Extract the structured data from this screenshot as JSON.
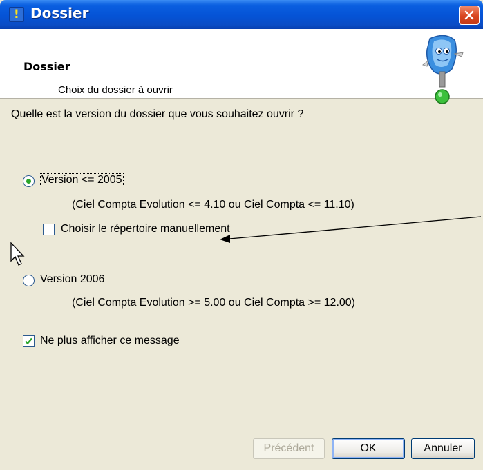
{
  "window": {
    "title": "Dossier",
    "icon": "help-doc-icon",
    "close_icon": "close-icon"
  },
  "header": {
    "title": "Dossier",
    "subtitle": "Choix du dossier à ouvrir",
    "mascot_icon": "ciel-mascot-icon"
  },
  "body": {
    "question": "Quelle est la version du dossier que vous souhaitez ouvrir ?",
    "option_2005": {
      "label": "Version <= 2005",
      "hint": "(Ciel Compta Evolution <= 4.10 ou Ciel Compta <= 11.10)",
      "selected": true
    },
    "manual_dir": {
      "label": "Choisir le répertoire manuellement",
      "checked": false
    },
    "option_2006": {
      "label": "Version 2006",
      "hint": "(Ciel Compta Evolution >= 5.00 ou Ciel Compta >= 12.00)",
      "selected": false
    },
    "no_show": {
      "label": "Ne plus afficher ce message",
      "checked": true
    }
  },
  "footer": {
    "prev_label": "Précédent",
    "ok_label": "OK",
    "cancel_label": "Annuler"
  },
  "colors": {
    "titlebar": "#0553d6",
    "dialog_bg": "#ece9d8",
    "check_green": "#2aa52a"
  }
}
